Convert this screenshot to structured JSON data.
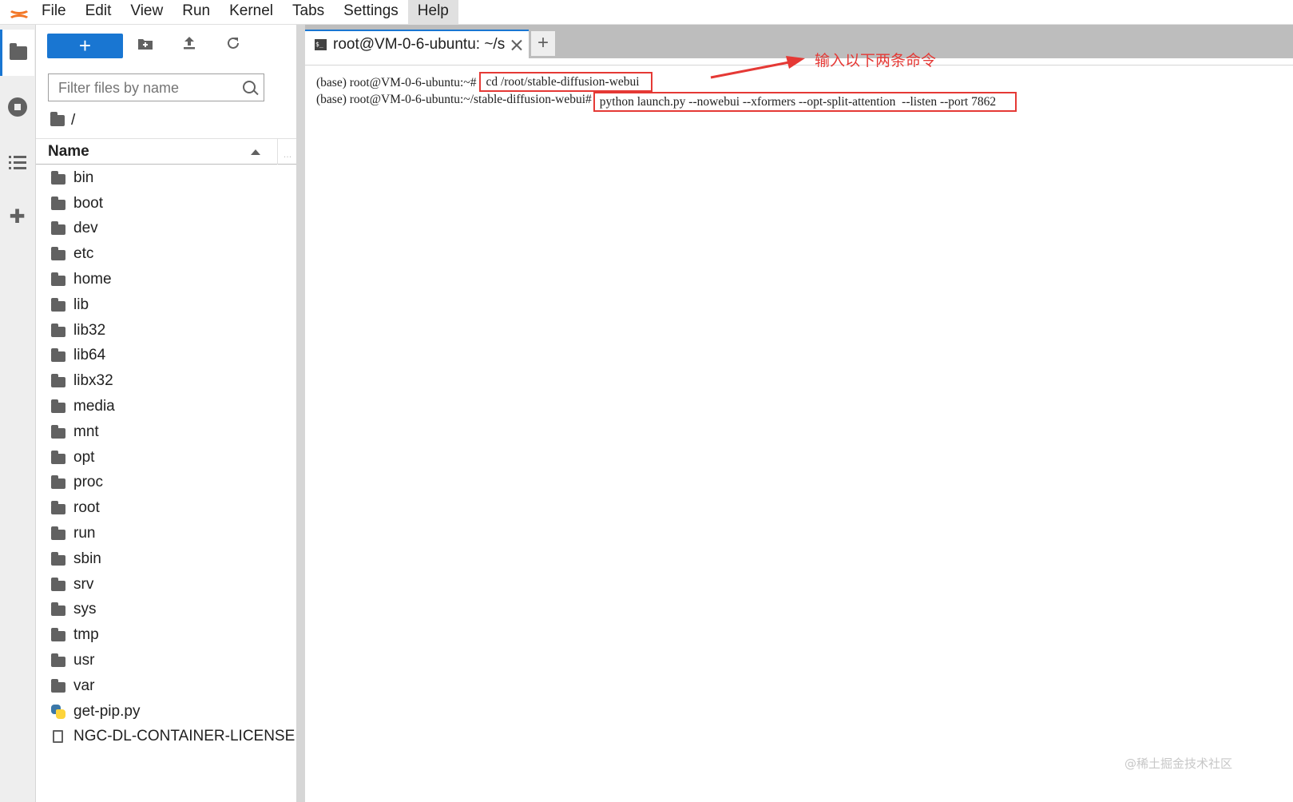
{
  "menubar": {
    "items": [
      "File",
      "Edit",
      "View",
      "Run",
      "Kernel",
      "Tabs",
      "Settings",
      "Help"
    ]
  },
  "toolbar": {
    "new_label": "+"
  },
  "filter": {
    "placeholder": "Filter files by name"
  },
  "breadcrumb": {
    "path": "/"
  },
  "filelist": {
    "header": "Name",
    "folders": [
      "bin",
      "boot",
      "dev",
      "etc",
      "home",
      "lib",
      "lib32",
      "lib64",
      "libx32",
      "media",
      "mnt",
      "opt",
      "proc",
      "root",
      "run",
      "sbin",
      "srv",
      "sys",
      "tmp",
      "usr",
      "var"
    ],
    "python_file": "get-pip.py",
    "file": "NGC-DL-CONTAINER-LICENSE"
  },
  "tab": {
    "title": "root@VM-0-6-ubuntu: ~/s",
    "icon_text": "$_",
    "add_label": "+"
  },
  "terminal": {
    "prompt1": "(base) root@VM-0-6-ubuntu:~#",
    "command1": "cd /root/stable-diffusion-webui",
    "prompt2": "(base) root@VM-0-6-ubuntu:~/stable-diffusion-webui#",
    "command2": "python launch.py --nowebui --xformers --opt-split-attention  --listen --port 7862"
  },
  "annotation": {
    "text": "输入以下两条命令",
    "color": "#e53935"
  },
  "watermark": "@稀土掘金技术社区",
  "colors": {
    "accent": "#1976d2",
    "logo": "#f37726",
    "highlight": "#e53935"
  }
}
